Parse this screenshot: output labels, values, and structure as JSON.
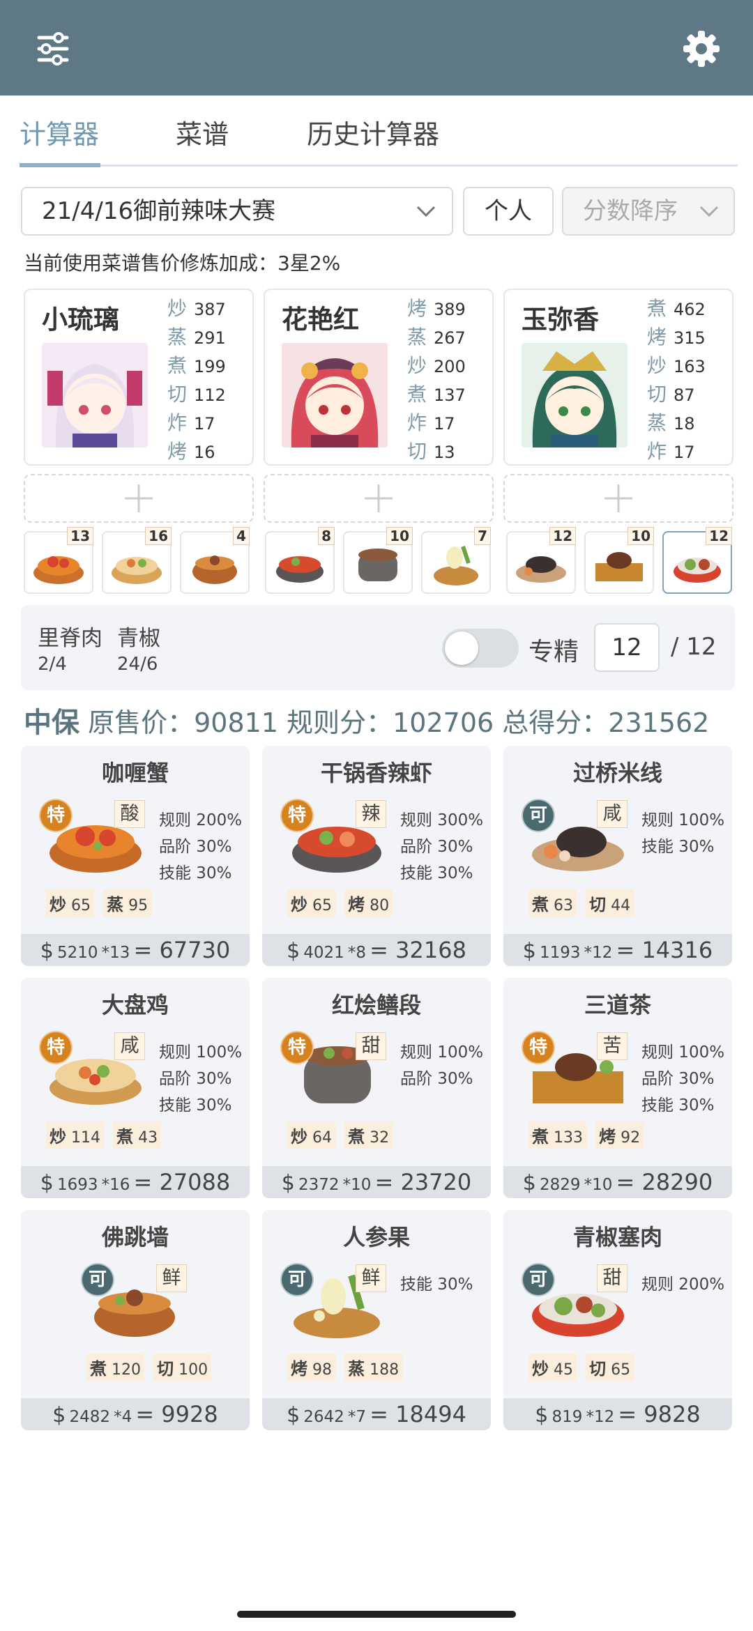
{
  "tabs": [
    {
      "label": "计算器"
    },
    {
      "label": "菜谱"
    },
    {
      "label": "历史计算器"
    }
  ],
  "filters": {
    "contest": "21/4/16御前辣味大赛",
    "mode": "个人",
    "sort": "分数降序"
  },
  "note": "当前使用菜谱售价修炼加成：3星2%",
  "chefs": [
    {
      "name": "小琉璃",
      "skills": [
        {
          "k": "炒",
          "v": "387"
        },
        {
          "k": "蒸",
          "v": "291"
        },
        {
          "k": "煮",
          "v": "199"
        },
        {
          "k": "切",
          "v": "112"
        },
        {
          "k": "炸",
          "v": "17"
        },
        {
          "k": "烤",
          "v": "16"
        }
      ]
    },
    {
      "name": "花艳红",
      "skills": [
        {
          "k": "烤",
          "v": "389"
        },
        {
          "k": "蒸",
          "v": "267"
        },
        {
          "k": "炒",
          "v": "200"
        },
        {
          "k": "煮",
          "v": "137"
        },
        {
          "k": "炸",
          "v": "17"
        },
        {
          "k": "切",
          "v": "13"
        }
      ]
    },
    {
      "name": "玉弥香",
      "skills": [
        {
          "k": "煮",
          "v": "462"
        },
        {
          "k": "烤",
          "v": "315"
        },
        {
          "k": "炒",
          "v": "163"
        },
        {
          "k": "切",
          "v": "87"
        },
        {
          "k": "蒸",
          "v": "18"
        },
        {
          "k": "炸",
          "v": "17"
        }
      ]
    }
  ],
  "dish_thumbs": [
    "13",
    "16",
    "4",
    "8",
    "10",
    "7",
    "12",
    "10",
    "12"
  ],
  "selected": {
    "ing1": "里脊肉",
    "ing1_qty": "2/4",
    "ing2": "青椒",
    "ing2_qty": "24/6",
    "special_label": "专精",
    "qty": "12",
    "qty_max": "/ 12"
  },
  "summary": {
    "grade": "中保",
    "orig_label": "原售价：",
    "orig": "90811",
    "rule_label": "规则分：",
    "rule": "102706",
    "total_label": "总得分：",
    "total": "231562"
  },
  "recipes": [
    {
      "name": "咖喱蟹",
      "rarity": "特",
      "flavor": "酸",
      "stats": [
        "规则 200%",
        "品阶 30%",
        "技能 30%"
      ],
      "reqs": [
        {
          "k": "炒",
          "v": "65"
        },
        {
          "k": "蒸",
          "v": "95"
        }
      ],
      "price": "5210",
      "mult": "*13",
      "total": "= 67730"
    },
    {
      "name": "干锅香辣虾",
      "rarity": "特",
      "flavor": "辣",
      "stats": [
        "规则 300%",
        "品阶 30%",
        "技能 30%"
      ],
      "reqs": [
        {
          "k": "炒",
          "v": "65"
        },
        {
          "k": "烤",
          "v": "80"
        }
      ],
      "price": "4021",
      "mult": "*8",
      "total": "= 32168"
    },
    {
      "name": "过桥米线",
      "rarity": "可",
      "flavor": "咸",
      "stats": [
        "规则 100%",
        "技能 30%"
      ],
      "reqs": [
        {
          "k": "煮",
          "v": "63"
        },
        {
          "k": "切",
          "v": "44"
        }
      ],
      "price": "1193",
      "mult": "*12",
      "total": "= 14316"
    },
    {
      "name": "大盘鸡",
      "rarity": "特",
      "flavor": "咸",
      "stats": [
        "规则 100%",
        "品阶 30%",
        "技能 30%"
      ],
      "reqs": [
        {
          "k": "炒",
          "v": "114"
        },
        {
          "k": "煮",
          "v": "43"
        }
      ],
      "price": "1693",
      "mult": "*16",
      "total": "= 27088"
    },
    {
      "name": "红烩鳝段",
      "rarity": "特",
      "flavor": "甜",
      "stats": [
        "规则 100%",
        "品阶 30%"
      ],
      "reqs": [
        {
          "k": "炒",
          "v": "64"
        },
        {
          "k": "煮",
          "v": "32"
        }
      ],
      "price": "2372",
      "mult": "*10",
      "total": "= 23720"
    },
    {
      "name": "三道茶",
      "rarity": "特",
      "flavor": "苦",
      "stats": [
        "规则 100%",
        "品阶 30%",
        "技能 30%"
      ],
      "reqs": [
        {
          "k": "煮",
          "v": "133"
        },
        {
          "k": "烤",
          "v": "92"
        }
      ],
      "price": "2829",
      "mult": "*10",
      "total": "= 28290"
    },
    {
      "name": "佛跳墙",
      "rarity": "可",
      "flavor": "鲜",
      "stats": [],
      "reqs": [
        {
          "k": "煮",
          "v": "120"
        },
        {
          "k": "切",
          "v": "100"
        }
      ],
      "price": "2482",
      "mult": "*4",
      "total": "= 9928"
    },
    {
      "name": "人参果",
      "rarity": "可",
      "flavor": "鲜",
      "stats": [
        "技能 30%"
      ],
      "reqs": [
        {
          "k": "烤",
          "v": "98"
        },
        {
          "k": "蒸",
          "v": "188"
        }
      ],
      "price": "2642",
      "mult": "*7",
      "total": "= 18494"
    },
    {
      "name": "青椒塞肉",
      "rarity": "可",
      "flavor": "甜",
      "stats": [
        "规则 200%"
      ],
      "reqs": [
        {
          "k": "炒",
          "v": "45"
        },
        {
          "k": "切",
          "v": "65"
        }
      ],
      "price": "819",
      "mult": "*12",
      "total": "= 9828"
    }
  ]
}
